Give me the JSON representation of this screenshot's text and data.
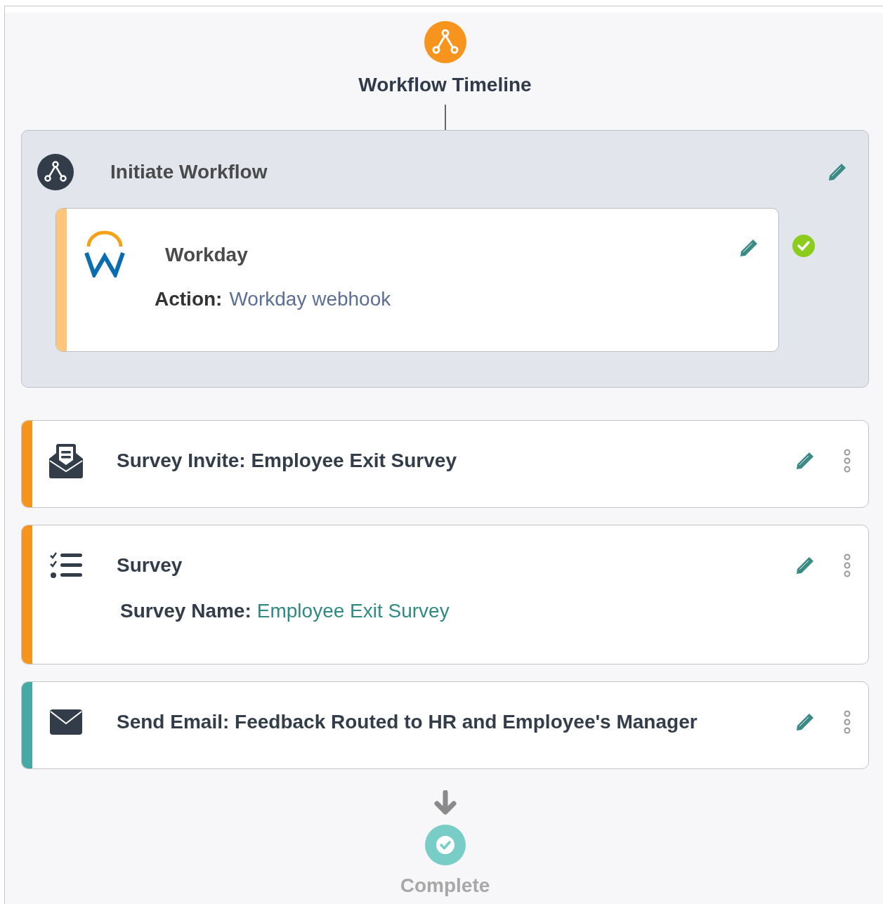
{
  "header": {
    "title": "Workflow Timeline"
  },
  "initiate": {
    "title": "Initiate Workflow",
    "integration": {
      "name": "Workday",
      "action_label": "Action:",
      "action_value": "Workday webhook",
      "verified": true
    }
  },
  "steps": [
    {
      "kind": "invite",
      "title": "Survey Invite: Employee Exit Survey",
      "color": "#f7941d"
    },
    {
      "kind": "survey",
      "title": "Survey",
      "color": "#f7941d",
      "detail_label": "Survey Name:",
      "detail_value": "Employee Exit Survey"
    },
    {
      "kind": "email",
      "title": "Send Email: Feedback Routed to HR and Employee's Manager",
      "color": "#45a9a5"
    }
  ],
  "footer": {
    "label": "Complete"
  }
}
